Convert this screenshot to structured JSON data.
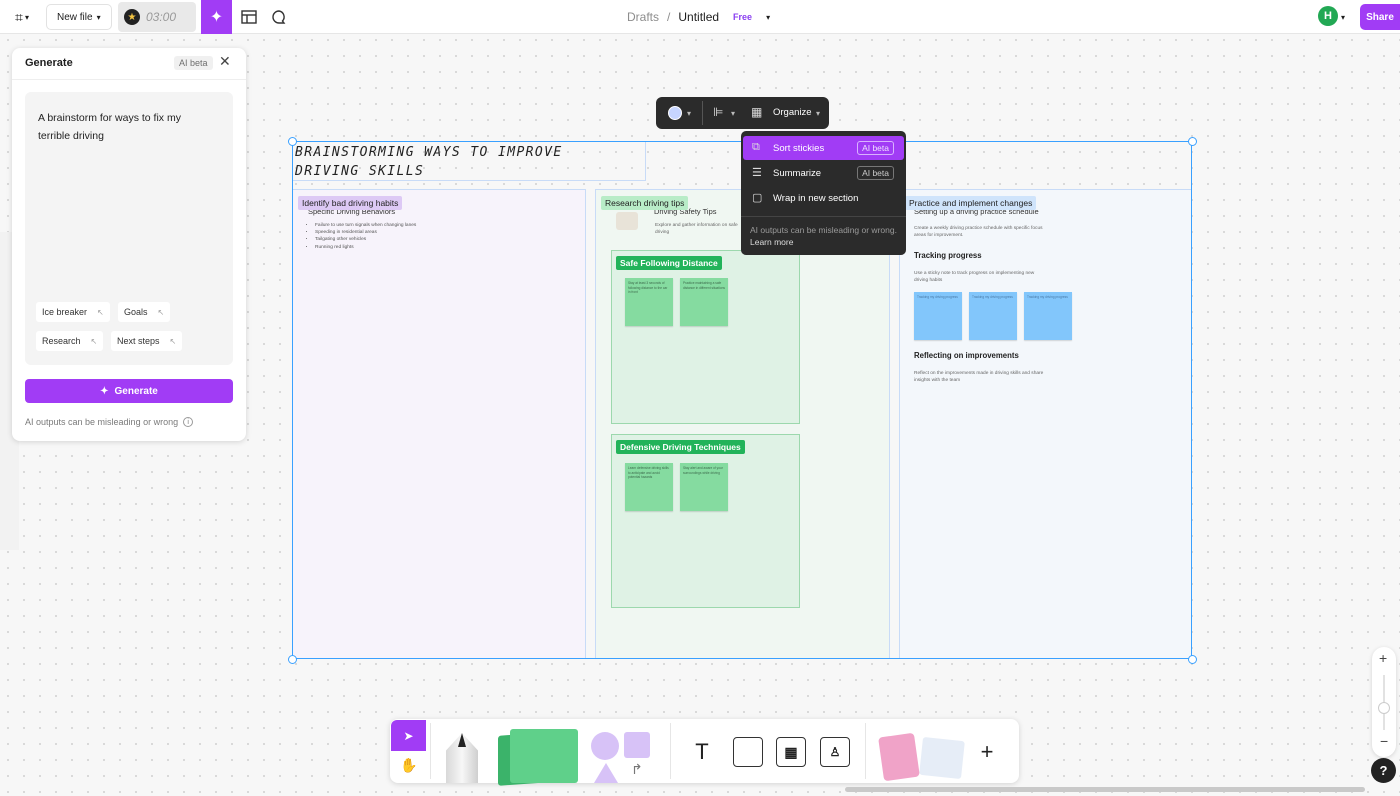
{
  "topbar": {
    "new_file": "New file",
    "timer": "03:00",
    "breadcrumb_parent": "Drafts",
    "breadcrumb_sep": "/",
    "file_name": "Untitled",
    "plan_badge": "Free",
    "avatar_initial": "H",
    "share": "Share"
  },
  "generate": {
    "title": "Generate",
    "beta": "AI beta",
    "prompt": "A brainstorm for ways to fix my terrible driving",
    "chips": [
      "Ice breaker",
      "Goals",
      "Research",
      "Next steps"
    ],
    "button": "Generate",
    "note": "AI outputs can be misleading or wrong"
  },
  "context_toolbar": {
    "organize": "Organize",
    "menu": [
      {
        "label": "Sort stickies",
        "badge": "AI beta",
        "active": true
      },
      {
        "label": "Summarize",
        "badge": "AI beta",
        "active": false
      },
      {
        "label": "Wrap in new section",
        "badge": "",
        "active": false
      }
    ],
    "note": "AI outputs can be misleading or wrong.",
    "learn_more": "Learn more"
  },
  "board": {
    "title_line1": "BRAINSTORMING WAYS TO IMPROVE",
    "title_line2": "DRIVING SKILLS",
    "sections": [
      {
        "label": "Identify bad driving habits",
        "sub": "Specific Driving Behaviors",
        "bullets": [
          "Failure to use turn signals when changing lanes",
          "Speeding in residential areas",
          "Tailgating other vehicles",
          "Running red lights"
        ]
      },
      {
        "label": "Research driving tips",
        "sub": "Driving Safety Tips",
        "desc": "Explore and gather information on safe driving",
        "groups": [
          {
            "label": "Safe Following Distance",
            "stickies": [
              "Stay at least 3 seconds of following distance to the car in front",
              "Practice maintaining a safe distance in different situations"
            ]
          },
          {
            "label": "Defensive Driving Techniques",
            "stickies": [
              "Learn defensive driving skills to anticipate and avoid potential hazards",
              "Stay alert and aware of your surroundings while driving"
            ]
          }
        ]
      },
      {
        "label": "Practice and implement changes",
        "sub": "Setting up a driving practice schedule",
        "desc": "Create a weekly driving practice schedule with specific focus areas for improvement.",
        "h_tracking": "Tracking progress",
        "tracking_desc": "Use a sticky note to track progress on implementing new driving habits",
        "stickies": [
          "Tracking my driving progress",
          "Tracking my driving progress",
          "Tracking my driving progress"
        ],
        "h_reflect": "Reflecting on improvements",
        "reflect_desc": "Reflect on the improvements made in driving skills and share insights with the team"
      }
    ]
  },
  "icons": {
    "ai": "sparkle-icon",
    "layout": "layout-icon",
    "comment": "comment-icon",
    "close": "close-icon",
    "help": "?"
  },
  "colors": {
    "accent": "#a13cf5",
    "selection": "#39a0ff",
    "sticky_green": "#85dba0",
    "sticky_blue": "#82c6fb"
  }
}
